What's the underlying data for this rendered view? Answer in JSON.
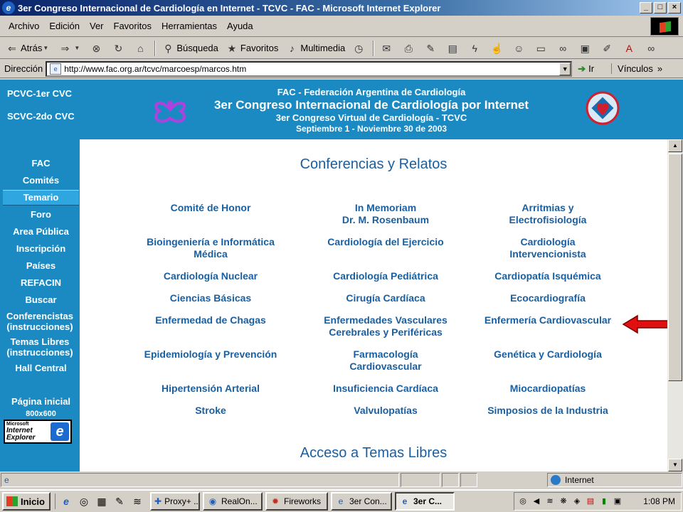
{
  "window": {
    "title": "3er Congreso Internacional de Cardiología en Internet - TCVC - FAC - Microsoft Internet Explorer",
    "buttons": [
      "_",
      "□",
      "×"
    ]
  },
  "menu": [
    "Archivo",
    "Edición",
    "Ver",
    "Favoritos",
    "Herramientas",
    "Ayuda"
  ],
  "toolbar": {
    "back": "Atrás",
    "search": "Búsqueda",
    "favorites": "Favoritos",
    "multimedia": "Multimedia"
  },
  "address": {
    "label": "Dirección",
    "url": "http://www.fac.org.ar/tcvc/marcoesp/marcos.htm",
    "go": "Ir",
    "links": "Vínculos"
  },
  "topnav": [
    "PCVC-1er CVC",
    "SCVC-2do CVC"
  ],
  "header": {
    "line1": "FAC - Federación Argentina de Cardiología",
    "line2": "3er Congreso Internacional de Cardiología por Internet",
    "line3": "3er Congreso Virtual de Cardiología - TCVC",
    "line4": "Septiembre 1 - Noviembre 30 de 2003"
  },
  "sidenav": [
    "FAC",
    "Comités",
    "Temario",
    "Foro",
    "Area Pública",
    "Inscripción",
    "Países",
    "REFACIN",
    "Buscar",
    "Conferencistas (instrucciones)",
    "Temas Libres (instrucciones)",
    "Hall Central"
  ],
  "sidenav_active": "Temario",
  "home": {
    "label": "Página inicial",
    "resolution": "800x600"
  },
  "ielogo": {
    "l1": "Microsoft",
    "l2": "Internet",
    "l3": "Explorer",
    "e": "e"
  },
  "content": {
    "title": "Conferencias y Relatos",
    "topics": [
      [
        "Comité de Honor",
        "In Memoriam\nDr. M. Rosenbaum",
        "Arritmias y\nElectrofisiología"
      ],
      [
        "Bioingeniería e Informática\nMédica",
        "Cardiología del Ejercicio",
        "Cardiología\nIntervencionista"
      ],
      [
        "Cardiología Nuclear",
        "Cardiología Pediátrica",
        "Cardiopatía Isquémica"
      ],
      [
        "Ciencias Básicas",
        "Cirugía Cardíaca",
        "Ecocardiografía"
      ],
      [
        "Enfermedad de Chagas",
        "Enfermedades Vasculares\nCerebrales y Periféricas",
        "Enfermería Cardiovascular"
      ],
      [
        "Epidemiología y Prevención",
        "Farmacología\nCardiovascular",
        "Genética y Cardiología"
      ],
      [
        "Hipertensión Arterial",
        "Insuficiencia Cardíaca",
        "Miocardiopatías"
      ],
      [
        "Stroke",
        "Valvulopatías",
        "Simposios de la Industria"
      ]
    ],
    "section2": "Acceso a Temas Libres",
    "highlighted": "Enfermería Cardiovascular"
  },
  "status": {
    "zone": "Internet"
  },
  "taskbar": {
    "start": "Inicio",
    "tasks": [
      "Proxy+ ...",
      "RealOn...",
      "Fireworks",
      "3er Con...",
      "3er C..."
    ],
    "active_task": "3er C...",
    "clock": "1:08 PM"
  },
  "colors": {
    "page_blue": "#1b8ac3",
    "link_blue": "#1a5fa0",
    "arrow_red": "#e01010"
  }
}
